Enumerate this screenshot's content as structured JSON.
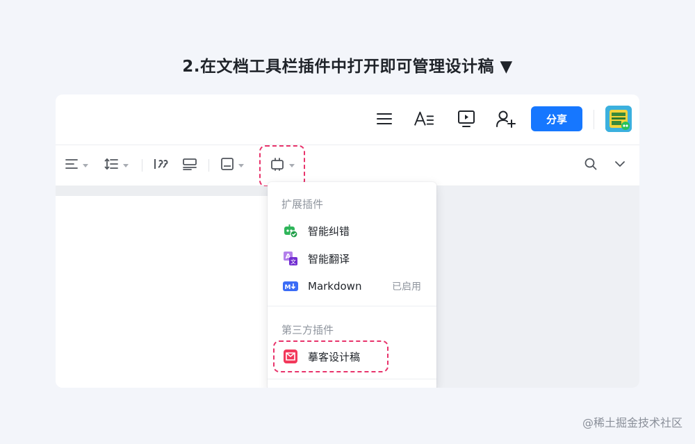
{
  "caption": "2.在文档工具栏插件中打开即可管理设计稿 ▼",
  "topbar": {
    "share_label": "分享",
    "icons": [
      "menu-icon",
      "text-format-icon",
      "present-icon",
      "add-user-icon"
    ]
  },
  "toolbar": {
    "icons": [
      "align-icon",
      "line-spacing-icon",
      "quote-icon",
      "highlight-block-icon",
      "card-icon",
      "plugin-icon",
      "search-icon",
      "chevron-down-icon"
    ]
  },
  "menu": {
    "section1_title": "扩展插件",
    "items": [
      {
        "label": "智能纠错",
        "icon": "smart-correct-icon",
        "status": ""
      },
      {
        "label": "智能翻译",
        "icon": "translate-icon",
        "status": ""
      },
      {
        "label": "Markdown",
        "icon": "markdown-icon",
        "status": "已启用"
      }
    ],
    "section2_title": "第三方插件",
    "third_party": [
      {
        "label": "摹客设计稿",
        "icon": "mockplus-icon"
      }
    ]
  },
  "colors": {
    "accent": "#1677ff",
    "highlight_dash": "#e8336b",
    "mockplus_red": "#f2385a"
  },
  "watermark": "@稀土掘金技术社区"
}
